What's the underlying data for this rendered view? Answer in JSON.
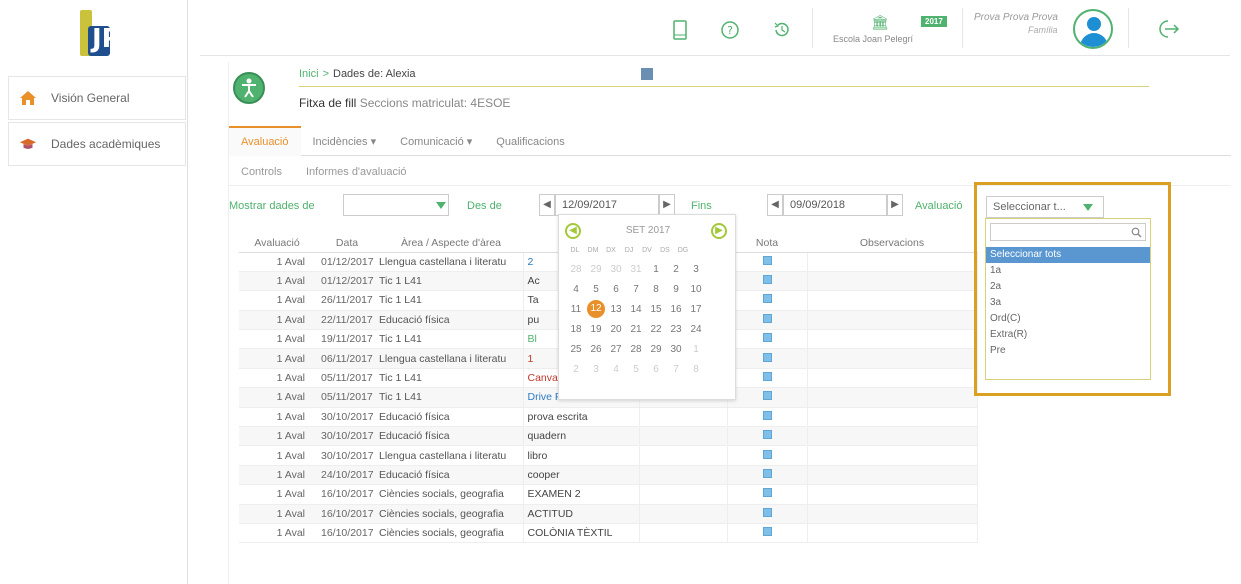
{
  "sidebar": {
    "logo_text": "JP",
    "items": [
      {
        "label": "Visión General"
      },
      {
        "label": "Dades acadèmiques"
      }
    ]
  },
  "header": {
    "school_year": "2017",
    "school_name": "Escola Joan Pelegrí",
    "user_name": "Prova Prova Prova",
    "user_role": "Família"
  },
  "page": {
    "breadcrumb_home": "Inici",
    "breadcrumb_arrow": ">",
    "breadcrumb_current": "Dades de: Alexia",
    "fitxa_label": "Fitxa de fill",
    "fitxa_sections": "Seccions matriculat: 4ESOE"
  },
  "tabs": [
    {
      "label": "Avaluació"
    },
    {
      "label": "Incidències ▾"
    },
    {
      "label": "Comunicació ▾"
    },
    {
      "label": "Qualificacions"
    }
  ],
  "subtabs": [
    {
      "label": "Controls"
    },
    {
      "label": "Informes d'avaluació"
    }
  ],
  "filters": {
    "mostrar_label": "Mostrar dades de",
    "des_de_label": "Des de",
    "des_de_value": "12/09/2017",
    "fins_label": "Fins",
    "fins_value": "09/09/2018",
    "avaluacio_label": "Avaluació",
    "avaluacio_value": "Seleccionar t..."
  },
  "table": {
    "headers": [
      "Avaluació",
      "Data",
      "Àrea / Aspecte d'àrea",
      "",
      "",
      "Nota",
      "Observacions"
    ],
    "rows": [
      {
        "aval": "1 Aval",
        "data": "01/12/2017",
        "area": "Llengua castellana i literatu",
        "desc": "2"
      },
      {
        "aval": "1 Aval",
        "data": "01/12/2017",
        "area": "Tic 1 L41",
        "desc": "Ac"
      },
      {
        "aval": "1 Aval",
        "data": "26/11/2017",
        "area": "Tic 1 L41",
        "desc": "Ta"
      },
      {
        "aval": "1 Aval",
        "data": "22/11/2017",
        "area": "Educació física",
        "desc": "pu"
      },
      {
        "aval": "1 Aval",
        "data": "19/11/2017",
        "area": "Tic 1 L41",
        "desc": "Bl"
      },
      {
        "aval": "1 Aval",
        "data": "06/11/2017",
        "area": "Llengua castellana i literatu",
        "desc": "1"
      },
      {
        "aval": "1 Aval",
        "data": "05/11/2017",
        "area": "Tic 1 L41",
        "desc": "Canva"
      },
      {
        "aval": "1 Aval",
        "data": "05/11/2017",
        "area": "Tic 1 L41",
        "desc": "Drive Formularis"
      },
      {
        "aval": "1 Aval",
        "data": "30/10/2017",
        "area": "Educació física",
        "desc": "prova escrita"
      },
      {
        "aval": "1 Aval",
        "data": "30/10/2017",
        "area": "Educació física",
        "desc": "quadern"
      },
      {
        "aval": "1 Aval",
        "data": "30/10/2017",
        "area": "Llengua castellana i literatu",
        "desc": "libro"
      },
      {
        "aval": "1 Aval",
        "data": "24/10/2017",
        "area": "Educació física",
        "desc": "cooper"
      },
      {
        "aval": "1 Aval",
        "data": "16/10/2017",
        "area": "Ciències socials, geografia",
        "desc": "EXAMEN 2"
      },
      {
        "aval": "1 Aval",
        "data": "16/10/2017",
        "area": "Ciències socials, geografia",
        "desc": "ACTITUD"
      },
      {
        "aval": "1 Aval",
        "data": "16/10/2017",
        "area": "Ciències socials, geografia",
        "desc": "COLÒNIA TÈXTIL"
      }
    ]
  },
  "calendar": {
    "month": "SET 2017",
    "dow": [
      "DL",
      "DM",
      "DX",
      "DJ",
      "DV",
      "DS",
      "DG"
    ],
    "weeks": [
      [
        "28",
        "29",
        "30",
        "31",
        "1",
        "2",
        "3"
      ],
      [
        "4",
        "5",
        "6",
        "7",
        "8",
        "9",
        "10"
      ],
      [
        "11",
        "12",
        "13",
        "14",
        "15",
        "16",
        "17"
      ],
      [
        "18",
        "19",
        "20",
        "21",
        "22",
        "23",
        "24"
      ],
      [
        "25",
        "26",
        "27",
        "28",
        "29",
        "30",
        "1"
      ],
      [
        "2",
        "3",
        "4",
        "5",
        "6",
        "7",
        "8"
      ]
    ],
    "selected": "12"
  },
  "dropdown": {
    "options": [
      "Seleccionar tots",
      "1a",
      "2a",
      "3a",
      "Ord(C)",
      "Extra(R)",
      "Pre"
    ]
  },
  "colors": {
    "accent": "#4fb26e",
    "tab_active": "#e8902a",
    "highlight_frame": "#d9a021",
    "selected_option": "#5a97d1"
  }
}
